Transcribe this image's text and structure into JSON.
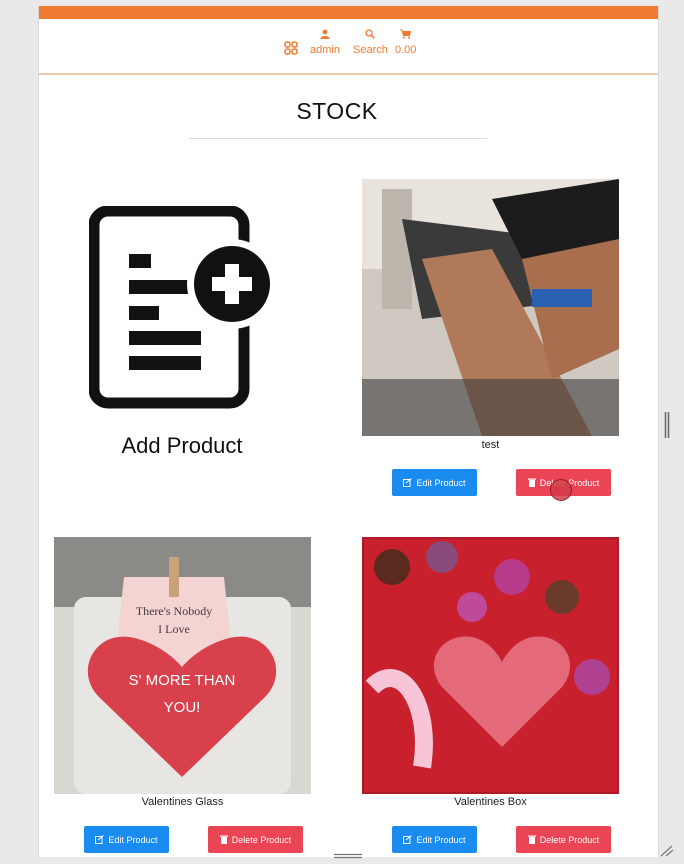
{
  "nav": {
    "accent": "#f07a2f",
    "menu_icon": "grid-icon",
    "user_label": "admin",
    "search_label": "Search",
    "cart_total": "0.00"
  },
  "page": {
    "title": "STOCK"
  },
  "add_product": {
    "label": "Add Product",
    "icon": "document-add-icon"
  },
  "products": [
    {
      "name": "test",
      "edit_label": "Edit Product",
      "delete_label": "Delete Product"
    },
    {
      "name": "Valentines Glass",
      "edit_label": "Edit Product",
      "delete_label": "Delete Product",
      "image_text": [
        "There's Nobody",
        "I Love",
        "S' MORE THAN",
        "YOU!"
      ]
    },
    {
      "name": "Valentines Box",
      "edit_label": "Edit Product",
      "delete_label": "Delete Product"
    }
  ]
}
